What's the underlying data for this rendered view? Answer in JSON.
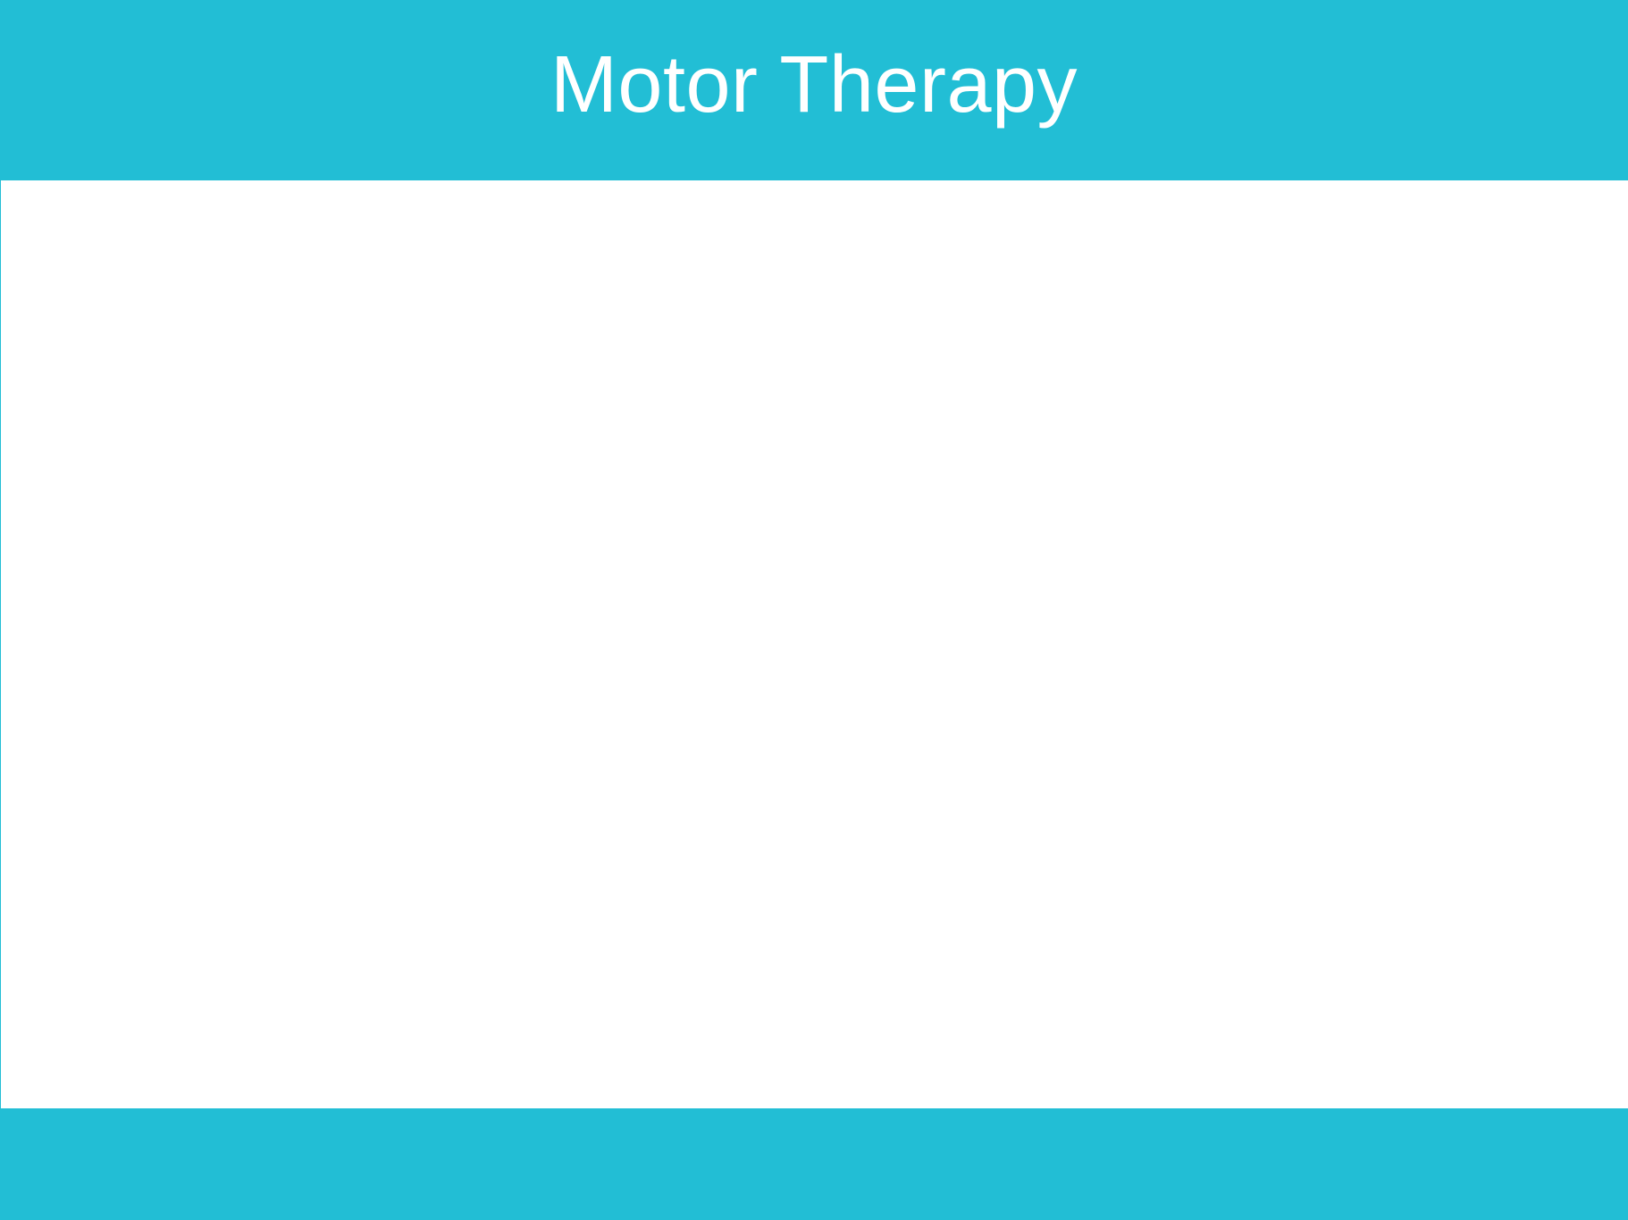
{
  "header": {
    "title": "Motor Therapy"
  },
  "colors": {
    "accent": "#22bed5",
    "content_background": "#ffffff",
    "title_text": "#ffffff"
  }
}
